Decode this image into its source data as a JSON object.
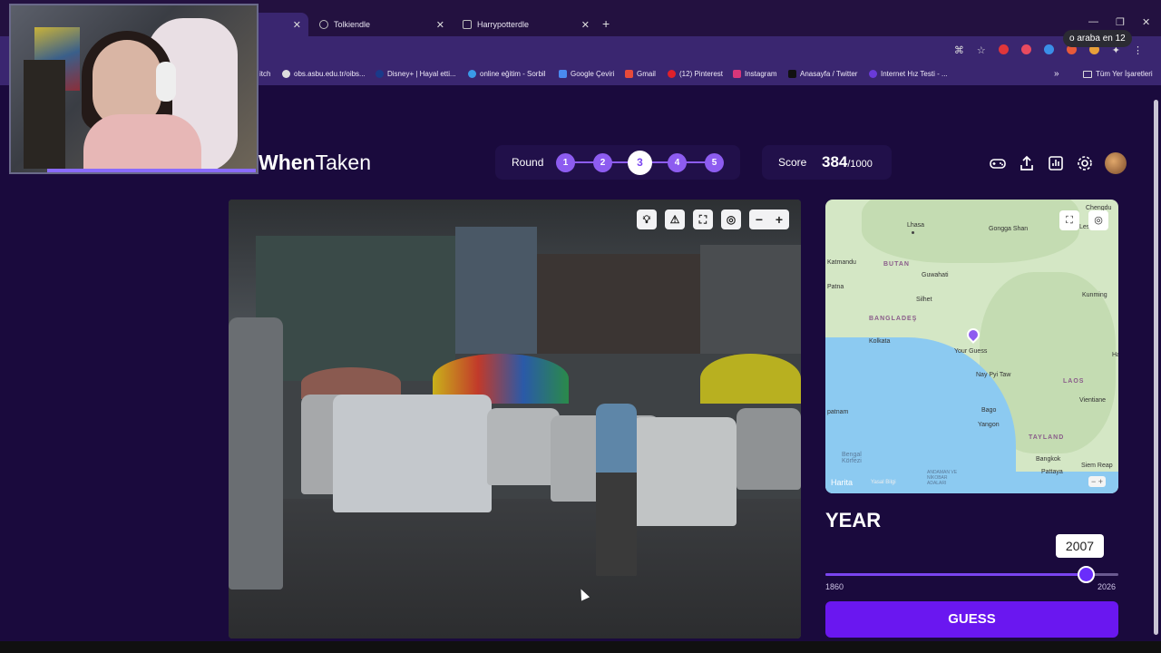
{
  "browser": {
    "tabs": [
      {
        "label": "",
        "active": true
      },
      {
        "label": "Tolkiendle"
      },
      {
        "label": "Harrypotterdle"
      }
    ],
    "new_tab": "+",
    "tooltip": "o araba en 12",
    "bookmarks": [
      {
        "label": "itch"
      },
      {
        "label": "obs.asbu.edu.tr/oibs..."
      },
      {
        "label": "Disney+ | Hayal etti..."
      },
      {
        "label": "online eğitim - Sorbil"
      },
      {
        "label": "Google Çeviri"
      },
      {
        "label": "Gmail"
      },
      {
        "label": "(12) Pinterest"
      },
      {
        "label": "Instagram"
      },
      {
        "label": "Anasayfa / Twitter"
      },
      {
        "label": "Internet Hız Testi - ..."
      }
    ],
    "bookmarks_more": "»",
    "all_bookmarks": "Tüm Yer İşaretleri"
  },
  "site": {
    "logo_part1": "When",
    "logo_part2": "Taken",
    "round": {
      "label": "Round",
      "items": [
        "1",
        "2",
        "3",
        "4",
        "5"
      ],
      "current": 3
    },
    "score": {
      "label": "Score",
      "value": "384",
      "max": "/1000"
    },
    "icons": [
      "gamepad-icon",
      "share-icon",
      "stats-icon",
      "settings-icon",
      "avatar"
    ]
  },
  "photo_tools": [
    "lightbulb-icon",
    "warning-icon",
    "fullscreen-icon",
    "focus-icon"
  ],
  "photo_zoom": {
    "minus": "−",
    "plus": "+"
  },
  "map": {
    "labels": {
      "lhasa": "Lhasa",
      "gongga": "Gongga Shan",
      "chengdu": "Chengdu",
      "leshan": "Leshan",
      "katmandu": "Katmandu",
      "butan": "BUTAN",
      "guwahati": "Guwahati",
      "patna": "Patna",
      "silhet": "Silhet",
      "kunming": "Kunming",
      "banglades": "BANGLADEŞ",
      "kolkata": "Kolkata",
      "your_guess": "Your Guess",
      "nay_pyi_taw": "Nay Pyi Taw",
      "laos": "LAOS",
      "vientiane": "Vientiane",
      "patnam": "patnam",
      "bago": "Bago",
      "yangon": "Yangon",
      "tayland": "TAYLAND",
      "bangkok": "Bangkok",
      "pattaya": "Pattaya",
      "siem_reap": "Siem Reap",
      "bengal": "Bengal\nKörfezi",
      "andaman": "ANDAMAN VE\nNİKOBAR\nADALARI",
      "hanoi_edge": "Ha"
    },
    "attribution": "Harita",
    "legal": "Yasal Bilgi",
    "zoom": "− +"
  },
  "year": {
    "label": "YEAR",
    "value": "2007",
    "min": "1860",
    "max": "2026",
    "fraction": 0.891
  },
  "guess_button": "GUESS",
  "colors": {
    "background": "#1a0a3d",
    "accent": "#6a17f0",
    "round_dot": "#8d5cf0"
  }
}
